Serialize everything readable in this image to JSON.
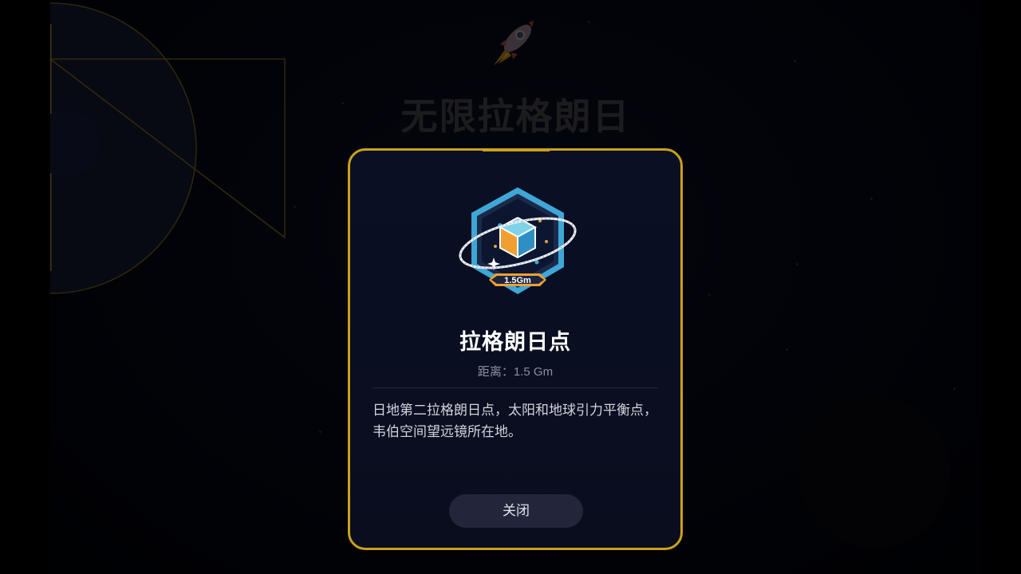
{
  "background": {
    "title": "无限拉格朗日",
    "rocket_icon": "rocket-icon"
  },
  "modal": {
    "badge_icon": "lagrange-point-badge-icon",
    "badge_label": "1.5Gm",
    "title": "拉格朗日点",
    "distance_label": "距离：",
    "distance_value": "1.5 Gm",
    "description": "日地第二拉格朗日点，太阳和地球引力平衡点，韦伯空间望远镜所在地。",
    "close_label": "关闭"
  },
  "colors": {
    "accent_gold": "#c9a21b",
    "modal_bg": "#0a0f24",
    "button_bg": "#23263a"
  }
}
